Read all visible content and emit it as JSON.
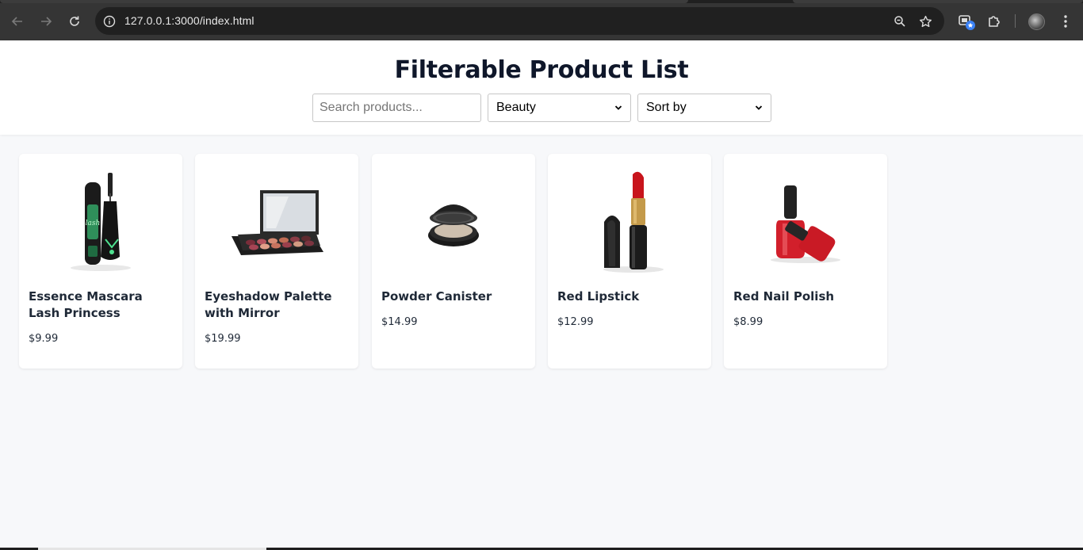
{
  "browser": {
    "url": "127.0.0.1:3000/index.html",
    "icons": {
      "back": "arrow-left-icon",
      "forward": "arrow-right-icon",
      "reload": "reload-icon",
      "info": "info-icon",
      "zoom": "zoom-icon",
      "bookmark": "star-icon",
      "extension_badge": "extension-badge-icon",
      "extensions": "puzzle-icon",
      "menu": "kebab-menu-icon"
    }
  },
  "header": {
    "title": "Filterable Product List",
    "search_placeholder": "Search products...",
    "category_selected": "Beauty",
    "sort_selected": "Sort by"
  },
  "products": [
    {
      "name": "Essence Mascara Lash Princess",
      "price": "$9.99",
      "icon": "mascara-image"
    },
    {
      "name": "Eyeshadow Palette with Mirror",
      "price": "$19.99",
      "icon": "eyeshadow-palette-image"
    },
    {
      "name": "Powder Canister",
      "price": "$14.99",
      "icon": "powder-canister-image"
    },
    {
      "name": "Red Lipstick",
      "price": "$12.99",
      "icon": "lipstick-image"
    },
    {
      "name": "Red Nail Polish",
      "price": "$8.99",
      "icon": "nail-polish-image"
    }
  ],
  "colors": {
    "page_bg": "#f7f8fa",
    "title": "#0f172a",
    "chrome_bg": "#353535",
    "omnibox_bg": "#202020"
  }
}
